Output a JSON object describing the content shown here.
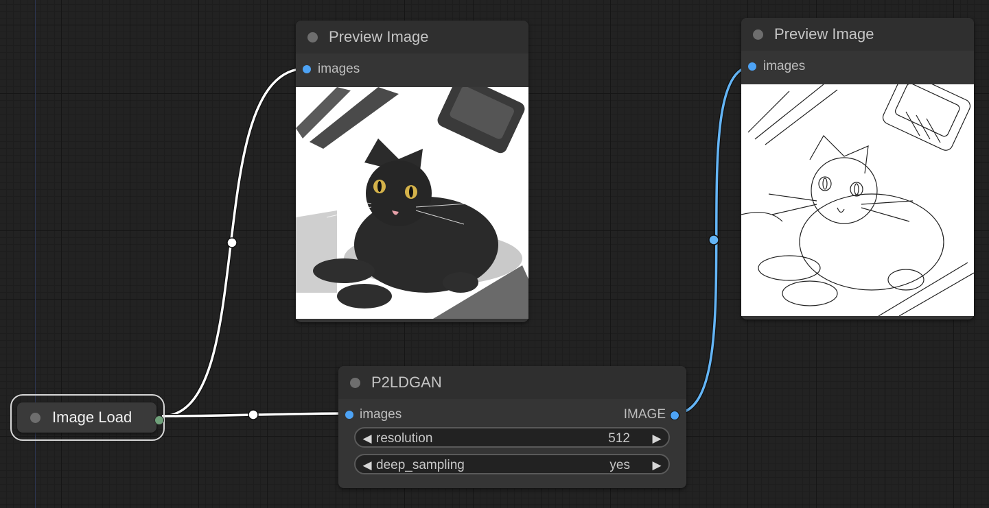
{
  "nodes": {
    "preview1": {
      "title": "Preview Image",
      "input": "images",
      "image": "cat-photo"
    },
    "preview2": {
      "title": "Preview Image",
      "input": "images",
      "image": "cat-line-drawing"
    },
    "p2ldgan": {
      "title": "P2LDGAN",
      "input": "images",
      "output": "IMAGE",
      "widgets": [
        {
          "label": "resolution",
          "value": "512"
        },
        {
          "label": "deep_sampling",
          "value": "yes"
        }
      ]
    },
    "image_load": {
      "title": "Image Load"
    }
  },
  "colors": {
    "canvas": "#222222",
    "node_body": "#353535",
    "node_title": "#2f2f2f",
    "link_image": "#ffffff",
    "link_image_typed": "#64b5f6",
    "slot_input": "#4da3f5"
  }
}
